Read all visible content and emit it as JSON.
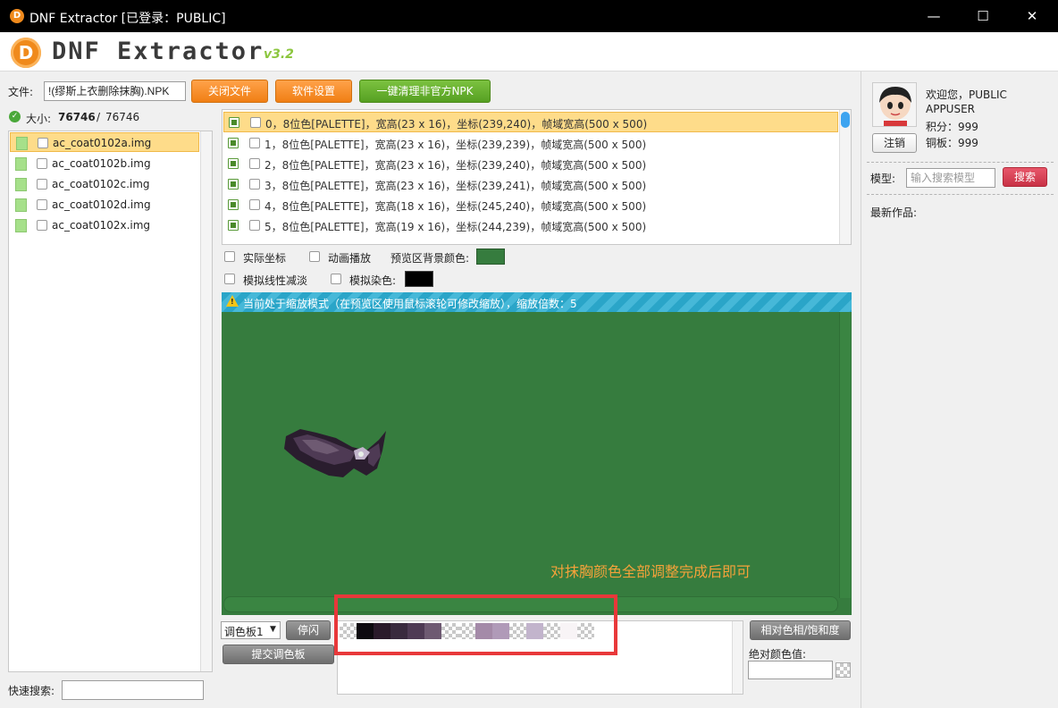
{
  "window": {
    "title": "DNF Extractor [已登录：PUBLIC]"
  },
  "header": {
    "logo_text": "DNF Extractor",
    "version": "v3.2",
    "logo_mark": "D"
  },
  "toolbar": {
    "file_label": "文件:",
    "file_value": "!(缪斯上衣删除抹胸).NPK",
    "close_file": "关闭文件",
    "settings": "软件设置",
    "clean_npk": "一键清理非官方NPK"
  },
  "size": {
    "label": "大小:",
    "current": "76746",
    "separator": "/",
    "total": "76746"
  },
  "files": [
    {
      "name": "ac_coat0102a.img",
      "selected": true
    },
    {
      "name": "ac_coat0102b.img"
    },
    {
      "name": "ac_coat0102c.img"
    },
    {
      "name": "ac_coat0102d.img"
    },
    {
      "name": "ac_coat0102x.img"
    }
  ],
  "frames": [
    "0，8位色[PALETTE]，宽高(23 x 16)，坐标(239,240)，帧域宽高(500 x 500)",
    "1，8位色[PALETTE]，宽高(23 x 16)，坐标(239,239)，帧域宽高(500 x 500)",
    "2，8位色[PALETTE]，宽高(23 x 16)，坐标(239,240)，帧域宽高(500 x 500)",
    "3，8位色[PALETTE]，宽高(23 x 16)，坐标(239,241)，帧域宽高(500 x 500)",
    "4，8位色[PALETTE]，宽高(18 x 16)，坐标(245,240)，帧域宽高(500 x 500)",
    "5，8位色[PALETTE]，宽高(19 x 16)，坐标(244,239)，帧域宽高(500 x 500)"
  ],
  "options": {
    "real_coords": "实际坐标",
    "animate": "动画播放",
    "bg_color_label": "预览区背景颜色:",
    "bg_color": "#367c3e",
    "linear_fade": "模拟线性减淡",
    "dye_label": "模拟染色:",
    "dye_color": "#000000"
  },
  "preview": {
    "notice": "当前处于缩放模式（在预览区使用鼠标滚轮可修改缩放），缩放倍数：5",
    "annotation": "对抹胸颜色全部调整完成后即可"
  },
  "palette": {
    "select_value": "调色板1",
    "stop": "停闪",
    "submit": "提交调色板",
    "relative": "相对色相/饱和度",
    "absolute_label": "绝对颜色值:",
    "swatches": [
      "checker",
      "#0d0a0f",
      "#2a1a2a",
      "#392a3e",
      "#4e3a54",
      "#6e5a72",
      "checker",
      "checker",
      "#a48aa8",
      "#b09ab8",
      "checker",
      "#c2b4cc",
      "checker",
      "#f8f4f6",
      "checker"
    ]
  },
  "search": {
    "label": "快速搜索:"
  },
  "user": {
    "welcome": "欢迎您，PUBLIC",
    "username": "APPUSER",
    "points": "积分：999",
    "copper": "铜板：999",
    "logout": "注销",
    "model_label": "模型:",
    "model_placeholder": "输入搜索模型",
    "search_btn": "搜索",
    "latest": "最新作品:"
  }
}
